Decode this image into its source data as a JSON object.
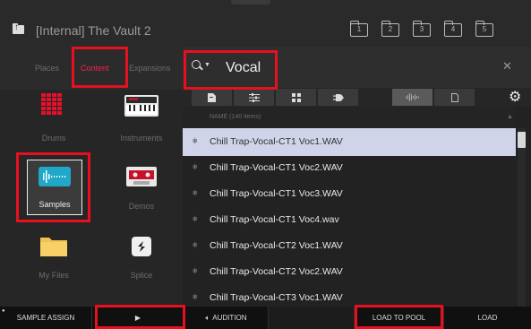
{
  "header": {
    "title": "[Internal] The Vault 2",
    "folders": [
      "1",
      "2",
      "3",
      "4",
      "5"
    ]
  },
  "left": {
    "tabs": [
      "Places",
      "Content",
      "Expansions"
    ],
    "active_tab": "Content",
    "tiles": [
      {
        "label": "Drums",
        "icon": "drum-pads-icon"
      },
      {
        "label": "Instruments",
        "icon": "keyboard-icon"
      },
      {
        "label": "Samples",
        "icon": "waveform-icon"
      },
      {
        "label": "Demos",
        "icon": "cassette-icon"
      },
      {
        "label": "My Files",
        "icon": "folder-icon"
      },
      {
        "label": "Splice",
        "icon": "splice-icon"
      }
    ],
    "selected_tile": "Samples"
  },
  "search": {
    "value": "Vocal"
  },
  "filters": [
    {
      "icon": "document-icon",
      "active": false
    },
    {
      "icon": "sliders-icon",
      "active": false
    },
    {
      "icon": "grid-icon",
      "active": false
    },
    {
      "icon": "plug-icon",
      "active": false
    },
    {
      "icon": "waveform-icon",
      "active": true
    },
    {
      "icon": "file-icon",
      "active": false
    }
  ],
  "list": {
    "header": "NAME (140 items)",
    "rows": [
      "Chill Trap-Vocal-CT1 Voc1.WAV",
      "Chill Trap-Vocal-CT1 Voc2.WAV",
      "Chill Trap-Vocal-CT1 Voc3.WAV",
      "Chill Trap-Vocal-CT1 Voc4.wav",
      "Chill Trap-Vocal-CT2 Voc1.WAV",
      "Chill Trap-Vocal-CT2 Voc2.WAV",
      "Chill Trap-Vocal-CT3 Voc1.WAV"
    ],
    "selected_row": 0
  },
  "bottom": {
    "sample_assign": "SAMPLE ASSIGN",
    "play_glyph": "▶",
    "audition": "AUDITION",
    "load_to_pool": "LOAD TO POOL",
    "load": "LOAD"
  },
  "colors": {
    "accent": "#ff1f4f",
    "highlight": "#e8101e",
    "selected_row": "#cfd4e8"
  }
}
